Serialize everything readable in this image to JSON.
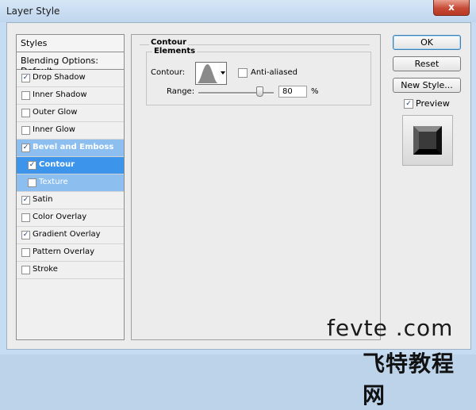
{
  "window": {
    "title": "Layer Style",
    "close_label": "x"
  },
  "styles_panel": {
    "header": "Styles",
    "blending_options": "Blending Options: Default",
    "items": [
      {
        "label": "Drop Shadow",
        "checked": true
      },
      {
        "label": "Inner Shadow",
        "checked": false
      },
      {
        "label": "Outer Glow",
        "checked": false
      },
      {
        "label": "Inner Glow",
        "checked": false
      },
      {
        "label": "Bevel and Emboss",
        "checked": true
      },
      {
        "label": "Contour",
        "checked": true
      },
      {
        "label": "Texture",
        "checked": false
      },
      {
        "label": "Satin",
        "checked": true
      },
      {
        "label": "Color Overlay",
        "checked": false
      },
      {
        "label": "Gradient Overlay",
        "checked": true
      },
      {
        "label": "Pattern Overlay",
        "checked": false
      },
      {
        "label": "Stroke",
        "checked": false
      }
    ]
  },
  "contour_panel": {
    "group_title": "Contour",
    "elements_title": "Elements",
    "contour_label": "Contour:",
    "anti_aliased_label": "Anti-aliased",
    "anti_aliased_checked": false,
    "range_label": "Range:",
    "range_value": "80",
    "range_unit": "%"
  },
  "buttons": {
    "ok": "OK",
    "reset": "Reset",
    "new_style": "New Style..."
  },
  "preview": {
    "label": "Preview",
    "checked": true
  },
  "watermark": {
    "line1": "fevte .com",
    "line2": "飞特教程网"
  },
  "colors": {
    "selected_row": "#3c95ea",
    "active_row": "#8cbff0",
    "title_bar": "#c6dcf2",
    "close_button": "#c64a36"
  }
}
